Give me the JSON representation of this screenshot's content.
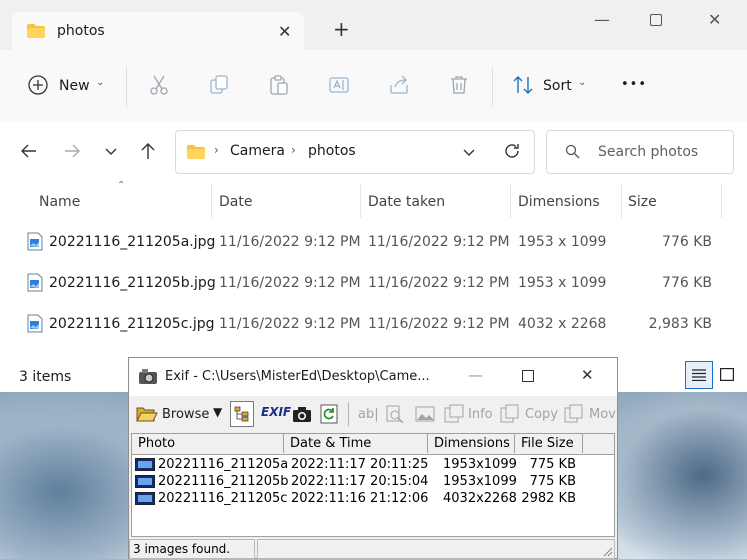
{
  "explorer": {
    "tab_title": "photos",
    "toolbar": {
      "new_label": "New",
      "sort_label": "Sort",
      "more_label": "•••"
    },
    "breadcrumb": [
      "Camera",
      "photos"
    ],
    "search_placeholder": "Search photos",
    "columns": [
      "Name",
      "Date",
      "Date taken",
      "Dimensions",
      "Size"
    ],
    "files": [
      {
        "name": "20221116_211205a.jpg",
        "date": "11/16/2022 9:12 PM",
        "date_taken": "11/16/2022 9:12 PM",
        "dimensions": "1953 x 1099",
        "size": "776 KB"
      },
      {
        "name": "20221116_211205b.jpg",
        "date": "11/16/2022 9:12 PM",
        "date_taken": "11/16/2022 9:12 PM",
        "dimensions": "1953 x 1099",
        "size": "776 KB"
      },
      {
        "name": "20221116_211205c.jpg",
        "date": "11/16/2022 9:12 PM",
        "date_taken": "11/16/2022 9:12 PM",
        "dimensions": "4032 x 2268",
        "size": "2,983 KB"
      }
    ],
    "status": "3 items",
    "accent": "#1e6fc8",
    "folder_color": "#f6c244"
  },
  "exif": {
    "title": "Exif - C:\\Users\\MisterEd\\Desktop\\Came...",
    "toolbar": {
      "browse": "Browse",
      "exif_icon_text": "EXIF",
      "info": "Info",
      "copy": "Copy",
      "move": "Mov"
    },
    "columns": [
      "Photo",
      "Date & Time",
      "Dimensions",
      "File Size"
    ],
    "rows": [
      {
        "photo": "20221116_211205a",
        "datetime": "2022:11:17 20:11:25",
        "dimensions": "1953x1099",
        "size": "775 KB"
      },
      {
        "photo": "20221116_211205b",
        "datetime": "2022:11:17 20:15:04",
        "dimensions": "1953x1099",
        "size": "775 KB"
      },
      {
        "photo": "20221116_211205c",
        "datetime": "2022:11:16 21:12:06",
        "dimensions": "4032x2268",
        "size": "2982 KB"
      }
    ],
    "status": "3 images found."
  }
}
